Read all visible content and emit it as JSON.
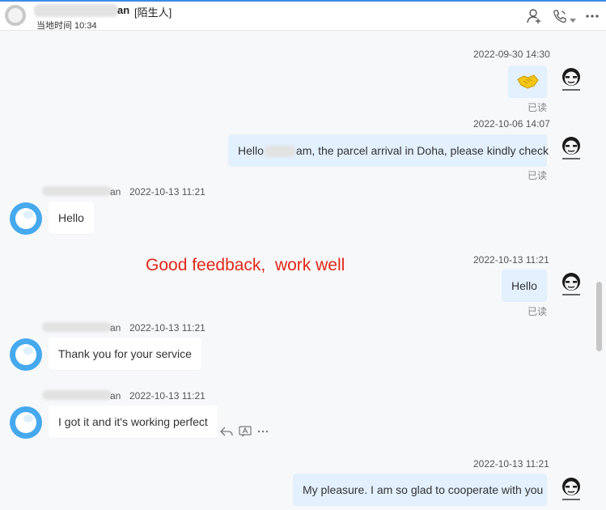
{
  "header": {
    "contact_name_suffix": "an",
    "contact_tag": "[陌生人]",
    "local_time": "当地时间 10:34",
    "icons": [
      "add-contact-icon",
      "phone-call-icon",
      "chevron-down-icon",
      "more-icon"
    ]
  },
  "annotation": {
    "text": "Good feedback,  work well",
    "color": "#e0281a"
  },
  "sender": {
    "name_suffix": "an"
  },
  "messages": [
    {
      "direction": "out",
      "time": "2022-09-30 14:30",
      "type": "emoji",
      "emoji": "handshake-emoji",
      "read": "已读"
    },
    {
      "direction": "out",
      "time": "2022-10-06 14:07",
      "text_before": "Hello",
      "text_after": "am, the parcel arrival in Doha, please kindly check",
      "read": "已读"
    },
    {
      "direction": "in",
      "time": "2022-10-13 11:21",
      "text": "Hello"
    },
    {
      "direction": "out",
      "time": "2022-10-13 11:21",
      "text": "Hello",
      "read": "已读"
    },
    {
      "direction": "in",
      "time": "2022-10-13 11:21",
      "text": "Thank you for your service"
    },
    {
      "direction": "in",
      "time": "2022-10-13 11:21",
      "text": "I got it and it's working perfect",
      "actions": [
        "reply-icon",
        "translate-icon",
        "more-icon"
      ]
    },
    {
      "direction": "out",
      "time": "2022-10-13 11:21",
      "text": "My pleasure. I am so glad to cooperate with you"
    }
  ],
  "colors": {
    "accent": "#3b8ee8",
    "bubble_out": "#e3f0fd",
    "bubble_in": "#ffffff",
    "background": "#f7f8fa",
    "peer_avatar": "#46a9ee"
  }
}
